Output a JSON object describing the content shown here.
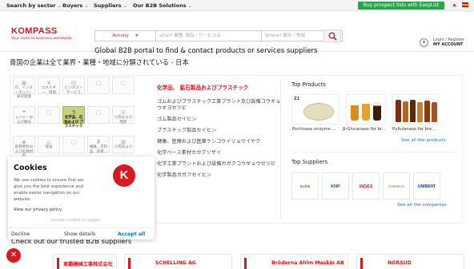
{
  "topbar": {
    "nav": [
      {
        "label": "Search by sector"
      },
      {
        "label": "Buyers"
      },
      {
        "label": "Suppliers"
      },
      {
        "label": "Our B2B Solutions"
      }
    ],
    "prospect_button": "Buy prospect lists with EasyList"
  },
  "header": {
    "logo": "KOMPASS",
    "tagline": "Your route to business worldwide",
    "search_activity": "Activity",
    "search_what_placeholder": "what? 業種, 製品・サービス名",
    "search_where_placeholder": "Where? 都市・地域",
    "portal_text": "Global B2B portal to find & contact products or services suppliers",
    "login_line1": "Login / Register",
    "login_line2": "MY ACCOUNT"
  },
  "page_title": "貴国の企業は全て業界・業種・地域に分類されている - 日本",
  "sectors": [
    {
      "label": "IT、インターネット、研究開発",
      "icon": "chip-icon",
      "active": false
    },
    {
      "label": "エネルギー、環境",
      "icon": "leaf-icon",
      "active": false
    },
    {
      "label": "ビジネス・サービス",
      "icon": "briefcase-icon",
      "active": false
    },
    {
      "label": "レジャーおよび観光",
      "icon": "umbrella-icon",
      "active": false
    },
    {
      "label": "化学品、石油および プラスチック",
      "icon": "flask-icon",
      "active": true
    },
    {
      "label": "小売および問屋",
      "icon": "cart-icon",
      "active": false
    },
    {
      "label": "鉱物原料および鉱物材料",
      "icon": "mineral-icon",
      "active": false
    },
    {
      "label": "建設",
      "icon": "crane-icon",
      "active": false
    },
    {
      "label": "繊維、衣料品、皮革…",
      "icon": "shirt-icon",
      "active": false
    },
    {
      "label": "小売および",
      "icon": "box-icon",
      "active": false
    }
  ],
  "category": {
    "title": "化学品、 鉱石製品およびプラスチック",
    "items": [
      "ゴムおよびプラスチック工業プラント及び設備コウギョウオヨセツビ",
      "ゴム製品セイヒン",
      "プラスチック製品セイヒン",
      "健康、医療および医薬ケンコウイリョウイヤク",
      "化学ベース素材カガクソザイ",
      "化学工業プラントおよび設備カガクコウギョウセツビ",
      "化学製品カガクセイヒン"
    ]
  },
  "top_products": {
    "title": "Top Products",
    "items": [
      {
        "caption": "Pectinase enzyme …"
      },
      {
        "caption": "β-Glucanase for br…"
      },
      {
        "caption": "Pullulanase for bre…"
      }
    ],
    "see_all": "See all the products"
  },
  "top_suppliers": {
    "title": "Top Suppliers",
    "logos": [
      "Koflik",
      "KNP",
      "INDEX",
      "CHEMCO",
      "UNIBENT"
    ],
    "see_all": "See all the companies"
  },
  "trusted": {
    "title": "Check out our trusted B2B suppliers",
    "cards": [
      {
        "name": "恵霸機械工業株式会社"
      },
      {
        "name": "SCHELLING AG"
      },
      {
        "name": "Bröderna Ahlm Maskin AB"
      },
      {
        "name": "NORSUD"
      }
    ]
  },
  "cookie": {
    "title": "Cookies",
    "body": "We use cookies to ensure that we give you the best experience and enable easier navigation on our website.",
    "privacy_link": "View our privacy policy",
    "consent_line": "Consent certified by axeptio",
    "decline": "Decline",
    "show_details": "Show details",
    "accept_all": "Accept all",
    "logo_letter": "K"
  },
  "colors": {
    "brand_red": "#d71920",
    "prospect_green": "#23a94a",
    "link_blue": "#1a6fc4"
  }
}
